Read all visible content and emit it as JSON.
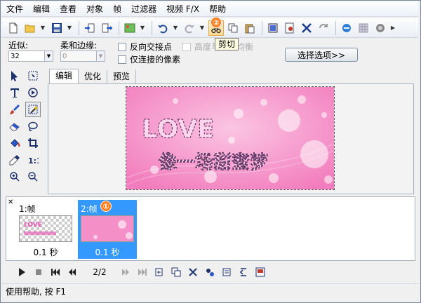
{
  "menu": [
    "文件",
    "编辑",
    "查看",
    "对象",
    "帧",
    "过滤器",
    "视频 F/X",
    "帮助"
  ],
  "tooltip": "剪切",
  "callouts": [
    "②",
    "①"
  ],
  "options": {
    "tolerance_label": "近似:",
    "tolerance_value": "32",
    "feather_label": "柔和边缘:",
    "feather_value": "0",
    "invert_label": "反向交接点",
    "contiguous_label": "仅连接的像素",
    "luma_label": "高度与颜色均衡",
    "select_button": "选择选项>>"
  },
  "tabs": [
    "编辑",
    "优化",
    "预览"
  ],
  "artwork": {
    "title_text": "LOVE",
    "subtitle_text": "像一场甜蜜梦",
    "background_color": "#f58fc8"
  },
  "frames": [
    {
      "label": "1:帧",
      "time": "0.1 秒",
      "selected": false
    },
    {
      "label": "2:帧",
      "time": "0.1 秒",
      "selected": true
    }
  ],
  "nav": {
    "counter": "2/2"
  },
  "status": "使用帮助, 按 F1"
}
